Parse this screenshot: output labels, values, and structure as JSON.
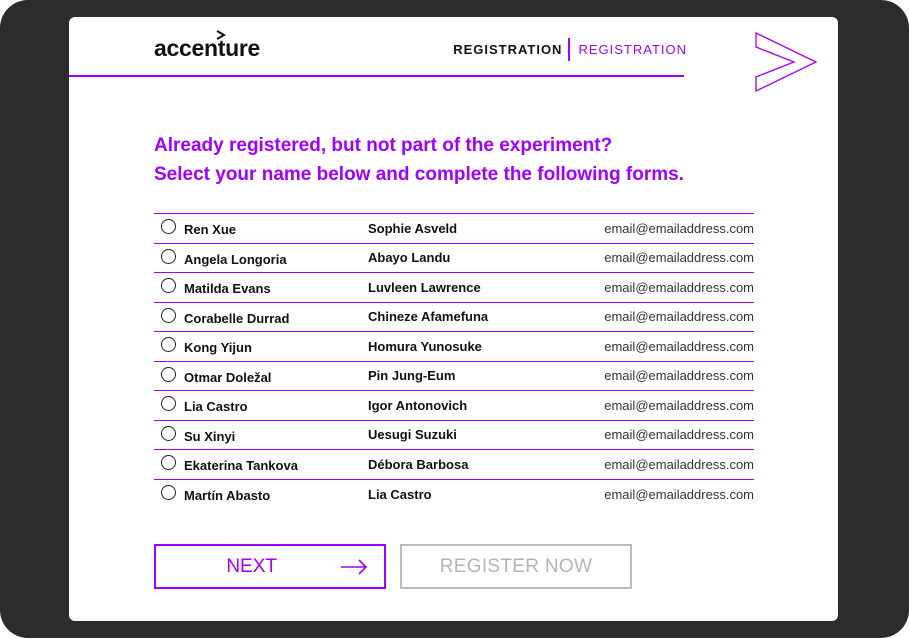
{
  "header": {
    "logo_text": "accenture",
    "nav_primary": "REGISTRATION",
    "nav_secondary": "REGISTRATION"
  },
  "heading": {
    "line1": "Already registered, but not part of the experiment?",
    "line2": "Select your name below and complete the following forms."
  },
  "people": [
    {
      "name": "Ren Xue",
      "contact": "Sophie Asveld",
      "email": "email@emailaddress.com",
      "selected": false
    },
    {
      "name": "Angela Longoria",
      "contact": "Abayo Landu",
      "email": "email@emailaddress.com",
      "selected": false
    },
    {
      "name": "Matilda Evans",
      "contact": "Luvleen Lawrence",
      "email": "email@emailaddress.com",
      "selected": false
    },
    {
      "name": "Corabelle Durrad",
      "contact": "Chineze Afamefuna",
      "email": "email@emailaddress.com",
      "selected": false
    },
    {
      "name": "Kong Yijun",
      "contact": "Homura Yunosuke",
      "email": "email@emailaddress.com",
      "selected": false
    },
    {
      "name": "Otmar Doležal",
      "contact": "Pin Jung-Eum",
      "email": "email@emailaddress.com",
      "selected": false
    },
    {
      "name": "Lia Castro",
      "contact": "Igor Antonovich",
      "email": "email@emailaddress.com",
      "selected": false
    },
    {
      "name": "Su Xinyi",
      "contact": "Uesugi Suzuki",
      "email": "email@emailaddress.com",
      "selected": false
    },
    {
      "name": "Ekaterina Tankova",
      "contact": "Débora Barbosa",
      "email": "email@emailaddress.com",
      "selected": false
    },
    {
      "name": "Martín Abasto",
      "contact": "Lia Castro",
      "email": "email@emailaddress.com",
      "selected": false
    }
  ],
  "buttons": {
    "next_label": "NEXT",
    "next_icon": "arrow-right-icon",
    "register_label": "REGISTER NOW"
  },
  "colors": {
    "accent": "#a100ff",
    "bezel": "#2c2c2c",
    "disabled": "#b5b5b5"
  }
}
